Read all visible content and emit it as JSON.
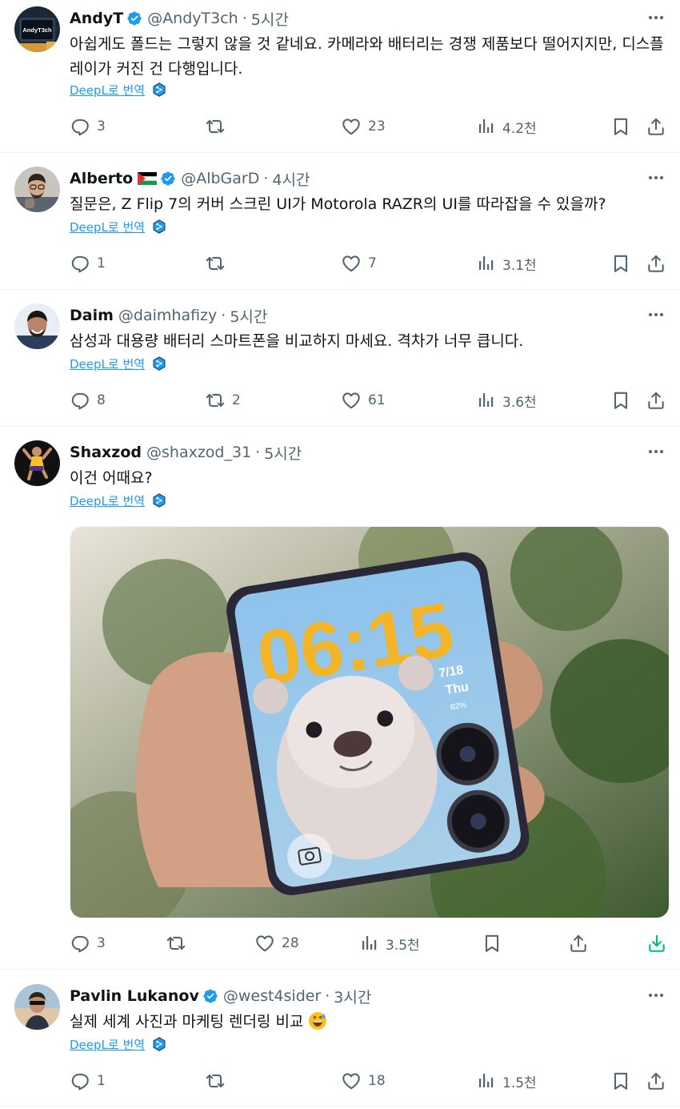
{
  "translate_label": "DeepL로 번역",
  "tweets": [
    {
      "name": "AndyT",
      "handle": "@AndyT3ch",
      "time": "5시간",
      "text": "아쉽게도 폴드는 그렇지 않을 것 같네요. 카메라와 배터리는 경쟁 제품보다 떨어지지만, 디스플레이가 커진 건 다행입니다.",
      "avatar_text": "AndyT3ch",
      "replies": "3",
      "retweets": "",
      "likes": "23",
      "views": "4.2천"
    },
    {
      "name": "Alberto",
      "handle": "@AlbGarD",
      "time": "4시간",
      "text": "질문은, Z Flip 7의 커버 스크린 UI가 Motorola RAZR의 UI를 따라잡을 수 있을까?",
      "replies": "1",
      "retweets": "",
      "likes": "7",
      "views": "3.1천"
    },
    {
      "name": "Daim",
      "handle": "@daimhafizy",
      "time": "5시간",
      "text": "삼성과 대용량 배터리 스마트폰을 비교하지 마세요. 격차가 너무 큽니다.",
      "replies": "8",
      "retweets": "2",
      "likes": "61",
      "views": "3.6천"
    },
    {
      "name": "Shaxzod",
      "handle": "@shaxzod_31",
      "time": "5시간",
      "text": "이건 어때요?",
      "replies": "3",
      "retweets": "",
      "likes": "28",
      "views": "3.5천",
      "media": {
        "clock": "06:15",
        "date": "7/18",
        "day": "Thu",
        "battery": "62%"
      }
    },
    {
      "name": "Pavlin Lukanov",
      "handle": "@west4sider",
      "time": "3시간",
      "text": "실제 세계 사진과 마케팅 렌더링 비교",
      "replies": "1",
      "retweets": "",
      "likes": "18",
      "views": "1.5천"
    }
  ],
  "colors": {
    "accent": "#1d9bf0",
    "secondary": "#536471",
    "download": "#00ba7c"
  }
}
